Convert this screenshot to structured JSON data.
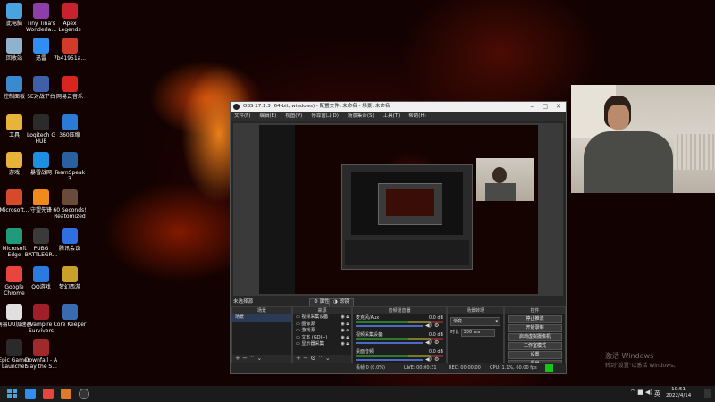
{
  "desktop_icons": [
    {
      "label": "此电脑",
      "icon": "computer-icon",
      "color": "#4aa3df"
    },
    {
      "label": "Tiny Tina's Wonderla...",
      "icon": "game-icon",
      "color": "#8c3fa8"
    },
    {
      "label": "Apex Legends",
      "icon": "apex-icon",
      "color": "#c8232c"
    },
    {
      "label": "回收站",
      "icon": "recycle-bin-icon",
      "color": "#8fb3cf"
    },
    {
      "label": "迅雷",
      "icon": "thunder-icon",
      "color": "#2f8ef0"
    },
    {
      "label": "7b41951a...",
      "icon": "game-icon",
      "color": "#d23a2a"
    },
    {
      "label": "控制面板",
      "icon": "control-panel-icon",
      "color": "#3a8ad0"
    },
    {
      "label": "5E对战平台",
      "icon": "game-platform-icon",
      "color": "#3f5fa8"
    },
    {
      "label": "网易云音乐",
      "icon": "music-icon",
      "color": "#d8261f"
    },
    {
      "label": "工具",
      "icon": "folder-icon",
      "color": "#e8b33a"
    },
    {
      "label": "Logitech G HUB",
      "icon": "logitech-icon",
      "color": "#2b2b2b"
    },
    {
      "label": "360压缩",
      "icon": "archive-icon",
      "color": "#2a7bd6"
    },
    {
      "label": "游戏",
      "icon": "folder-icon",
      "color": "#e8b33a"
    },
    {
      "label": "暴雪战网",
      "icon": "battlenet-icon",
      "color": "#1d8fe0"
    },
    {
      "label": "TeamSpeak 3",
      "icon": "teamspeak-icon",
      "color": "#2a5fa0"
    },
    {
      "label": "Microsoft...",
      "icon": "office-icon",
      "color": "#d44a2a"
    },
    {
      "label": "守望先锋",
      "icon": "overwatch-icon",
      "color": "#f08a1c"
    },
    {
      "label": "60 Seconds! Reatomized",
      "icon": "game-icon",
      "color": "#6a4a3a"
    },
    {
      "label": "Microsoft Edge",
      "icon": "edge-icon",
      "color": "#1f9b7a"
    },
    {
      "label": "PUBG BATTLEGR...",
      "icon": "pubg-icon",
      "color": "#3a3a3a"
    },
    {
      "label": "腾讯会议",
      "icon": "meeting-icon",
      "color": "#2f6fe0"
    },
    {
      "label": "Google Chrome",
      "icon": "chrome-icon",
      "color": "#e8453c"
    },
    {
      "label": "QQ游戏",
      "icon": "qq-game-icon",
      "color": "#2a7be0"
    },
    {
      "label": "梦幻西游",
      "icon": "game-icon",
      "color": "#c8a02a"
    },
    {
      "label": "网易UU加速器",
      "icon": "uu-icon",
      "color": "#e0e0e0"
    },
    {
      "label": "Vampire Survivors",
      "icon": "game-icon",
      "color": "#a0202a"
    },
    {
      "label": "Core Keeper",
      "icon": "game-icon",
      "color": "#3a6ab0"
    },
    {
      "label": "Epic Games Launcher",
      "icon": "epic-icon",
      "color": "#2a2a2a"
    },
    {
      "label": "Downfall - A Slay the S...",
      "icon": "game-icon",
      "color": "#a02a2a"
    }
  ],
  "obs": {
    "title": "OBS 27.1.3 (64-bit, windows) - 配置文件: 未命名 - 场景: 未命名",
    "menu": [
      "文件(F)",
      "编辑(E)",
      "视图(V)",
      "停靠窗口(D)",
      "场景集合(S)",
      "工具(T)",
      "帮助(H)"
    ],
    "no_source": "未选择源",
    "properties": "属性",
    "filters": "滤镜",
    "docks": {
      "scenes": {
        "title": "场景",
        "items": [
          "场景"
        ]
      },
      "sources": {
        "title": "来源",
        "items": [
          "视频采集设备",
          "图像源",
          "游戏源",
          "文本 (GDI+)",
          "显示器采集"
        ]
      },
      "mixer": {
        "title": "音频混音器",
        "channels": [
          {
            "name": "麦克风/Aux",
            "level": "0.0 dB"
          },
          {
            "name": "视频采集设备",
            "level": "0.0 dB"
          },
          {
            "name": "桌面音频",
            "level": "0.0 dB"
          }
        ]
      },
      "transitions": {
        "title": "场景转场",
        "type": "渐变",
        "duration_label": "时长",
        "duration": "300 ms"
      },
      "controls": {
        "title": "控件",
        "buttons": [
          "停止推流",
          "开始录制",
          "启动虚拟摄像机",
          "工作室模式",
          "设置",
          "退出"
        ]
      }
    },
    "status": {
      "dropped": "丢帧 0 (0.0%)",
      "live": "LIVE: 00:00:31",
      "rec": "REC: 00:00:00",
      "cpu": "CPU: 1.1%, 60.00 fps",
      "ok_color": "#15c415"
    }
  },
  "activation": {
    "title": "激活 Windows",
    "subtitle": "转到\"设置\"以激活 Windows。"
  },
  "taskbar": {
    "time": "10:51",
    "date": "2022/4/14",
    "lang": "英",
    "apps": [
      "start-icon",
      "search-icon",
      "task-view-icon",
      "explorer-icon",
      "obs-icon"
    ]
  }
}
